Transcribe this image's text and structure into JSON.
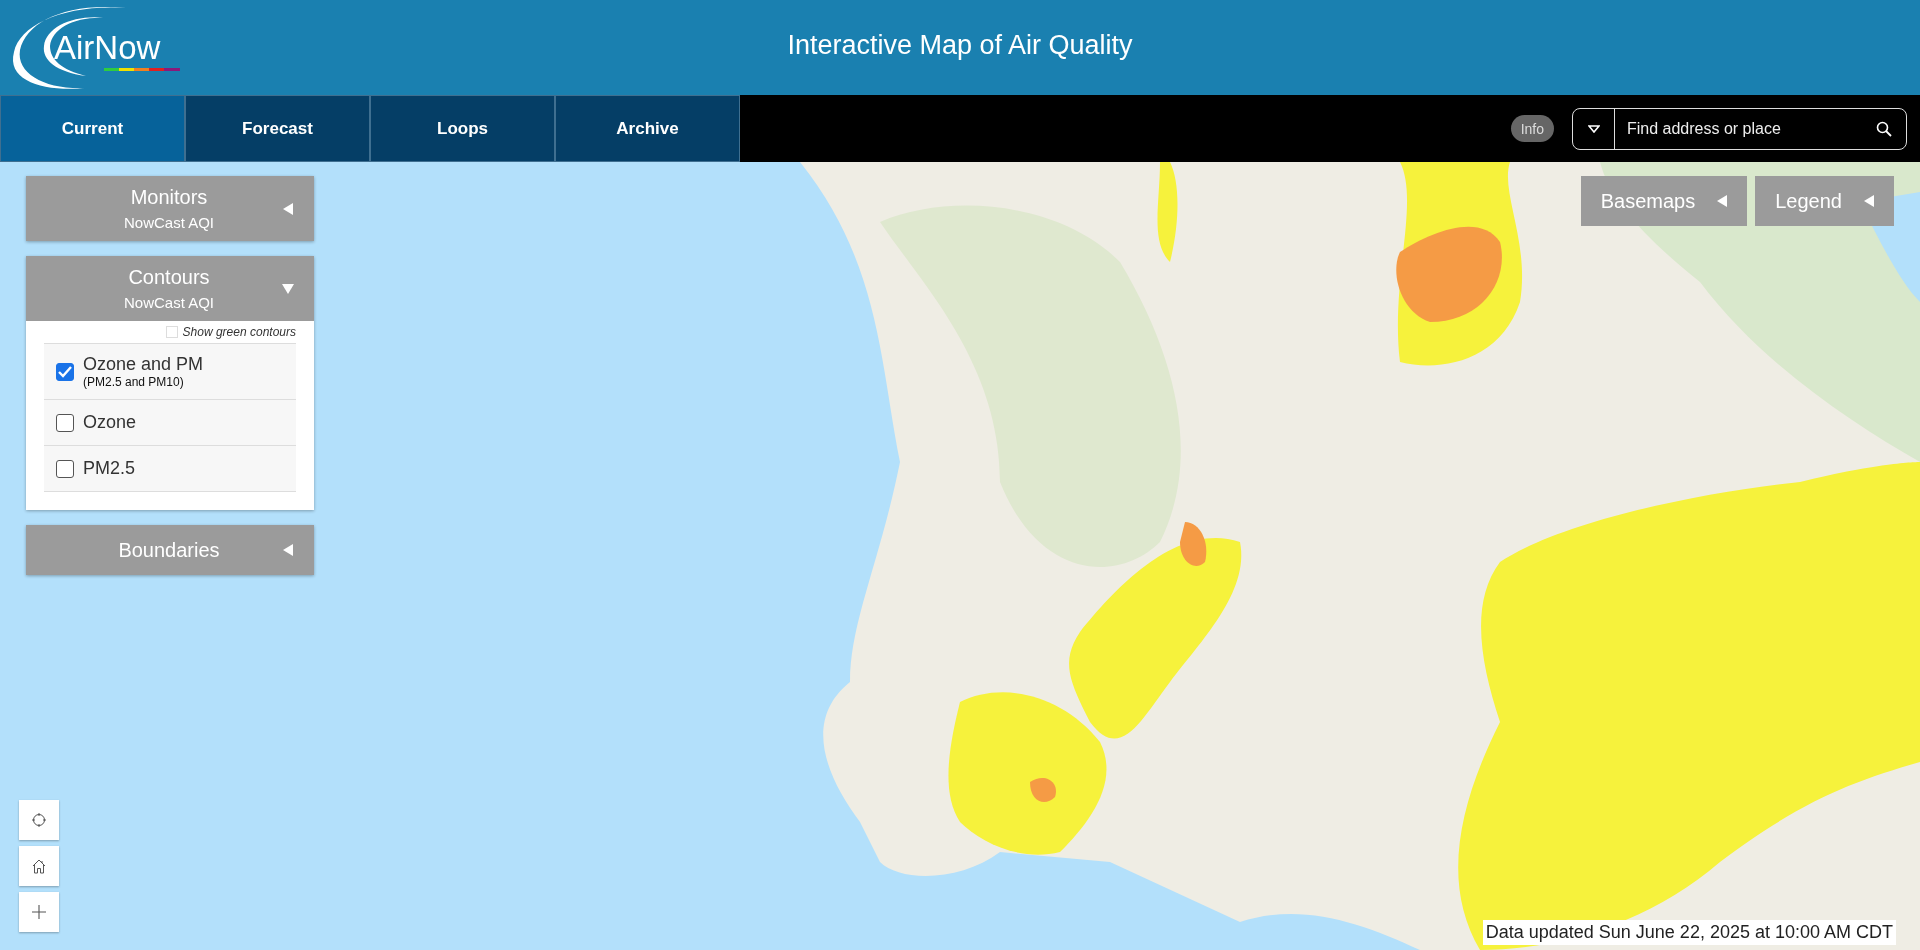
{
  "header": {
    "logo": "AirNow",
    "title": "Interactive Map of Air Quality"
  },
  "tabs": [
    {
      "label": "Current",
      "selected": true
    },
    {
      "label": "Forecast",
      "selected": false
    },
    {
      "label": "Loops",
      "selected": false
    },
    {
      "label": "Archive",
      "selected": false
    }
  ],
  "info_button": "Info",
  "search": {
    "placeholder": "Find address or place"
  },
  "map_buttons": [
    "Basemaps",
    "Legend"
  ],
  "panels": [
    {
      "title": "Monitors",
      "subtitle": "NowCast AQI",
      "expanded": false
    },
    {
      "title": "Contours",
      "subtitle": "NowCast AQI",
      "expanded": true,
      "option": {
        "label": "Show green contours",
        "checked": false
      },
      "items": [
        {
          "label": "Ozone and PM",
          "note": "(PM2.5 and PM10)",
          "checked": true
        },
        {
          "label": "Ozone",
          "checked": false
        },
        {
          "label": "PM2.5",
          "checked": false
        }
      ]
    },
    {
      "title": "Boundaries",
      "expanded": false
    }
  ],
  "map": {
    "kind": "picture"
  },
  "map_controls": [
    {
      "kind": "locate"
    },
    {
      "kind": "home"
    },
    {
      "kind": "zoom-in"
    }
  ],
  "status": "Data updated Sun June 22, 2025 at 10:00 AM CDT"
}
